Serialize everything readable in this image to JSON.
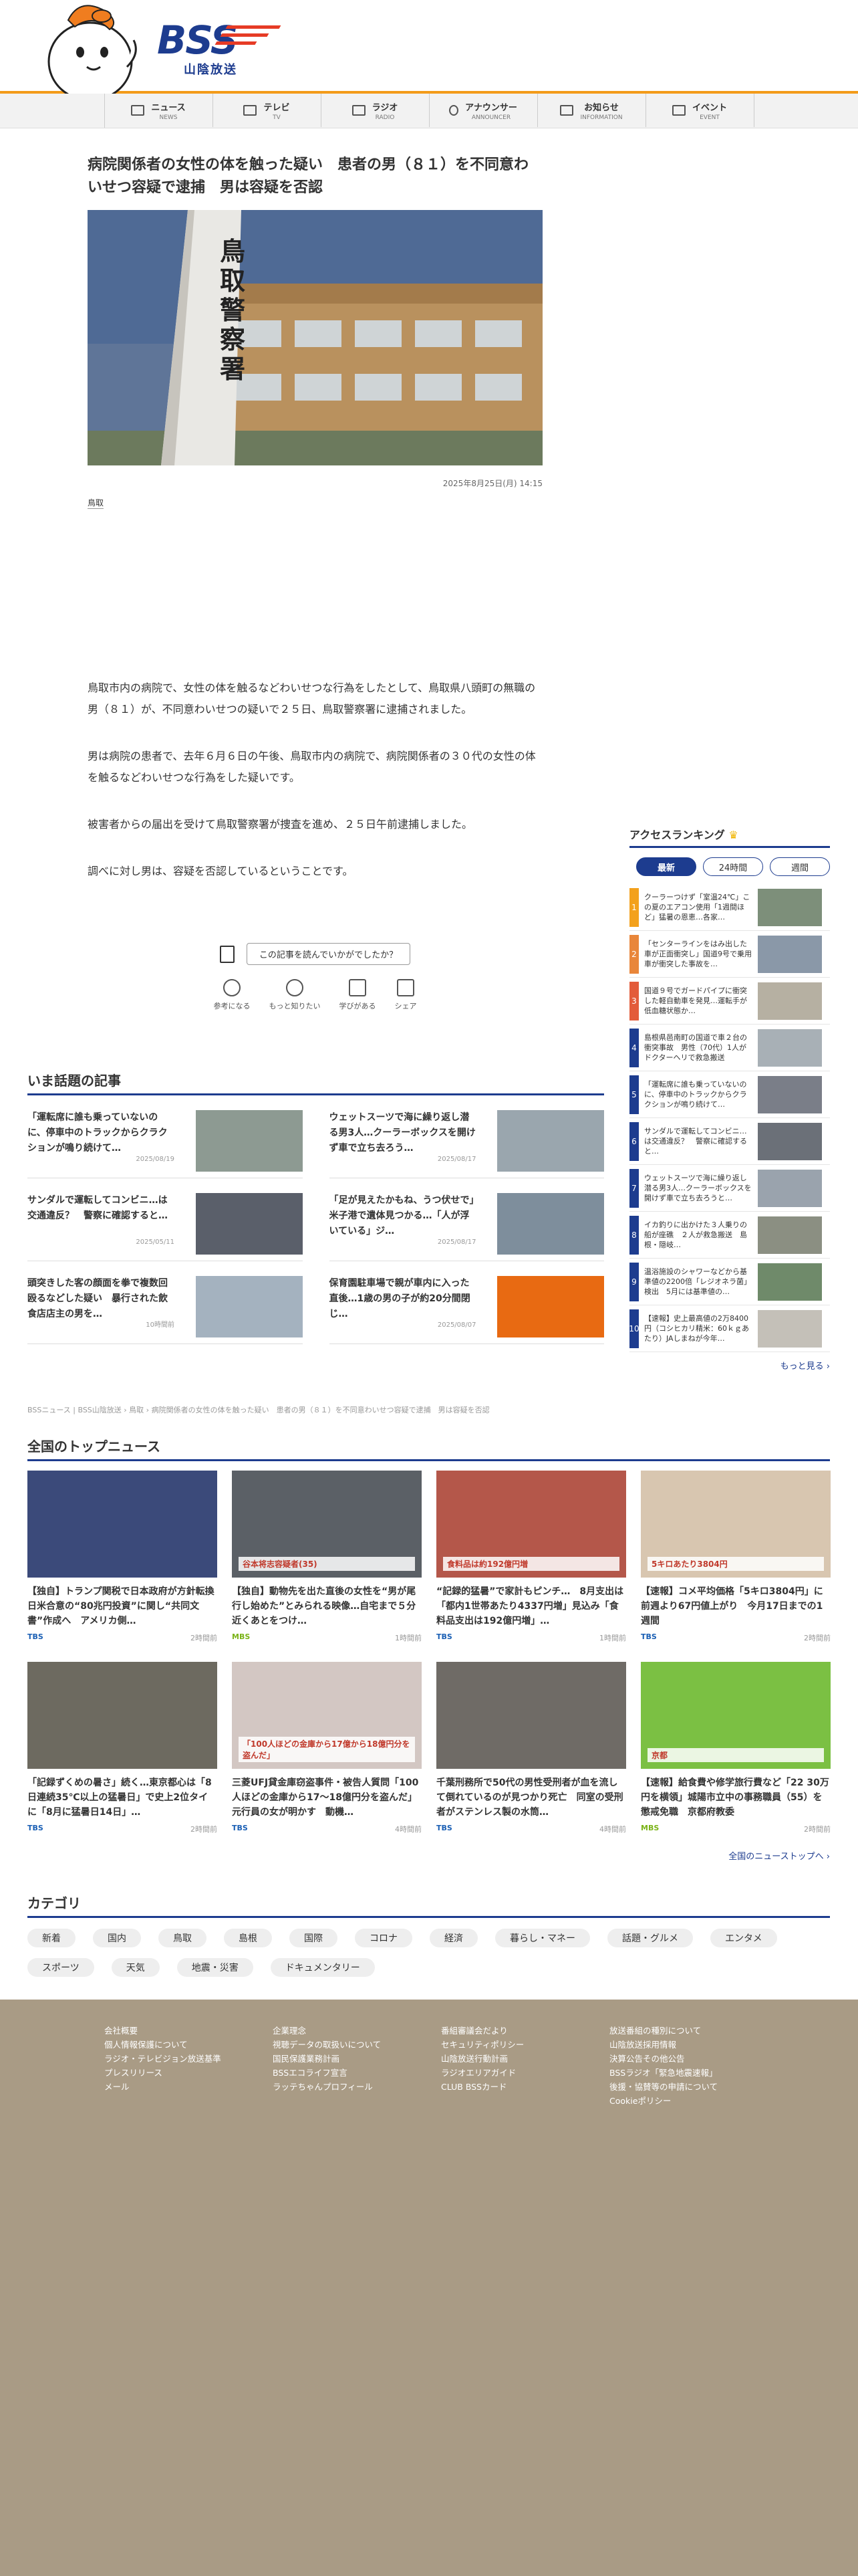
{
  "header": {
    "logo_text": "BSS",
    "logo_sub": "山陰放送",
    "colors": {
      "brand_blue": "#1d3c8f",
      "accent_orange": "#f39b1a",
      "accent_red": "#e63b25"
    }
  },
  "nav": [
    {
      "ja": "ニュース",
      "en": "NEWS",
      "icon": "news-icon"
    },
    {
      "ja": "テレビ",
      "en": "TV",
      "icon": "tv-icon"
    },
    {
      "ja": "ラジオ",
      "en": "RADIO",
      "icon": "radio-icon"
    },
    {
      "ja": "アナウンサー",
      "en": "ANNOUNCER",
      "icon": "microphone-icon"
    },
    {
      "ja": "お知らせ",
      "en": "INFORMATION",
      "icon": "megaphone-icon"
    },
    {
      "ja": "イベント",
      "en": "EVENT",
      "icon": "calendar-icon"
    }
  ],
  "article": {
    "title": "病院関係者の女性の体を触った疑い　患者の男（８１）を不同意わいせつ容疑で逮捕　男は容疑を否認",
    "photo_sign": "鳥取警察署",
    "date": "2025年8月25日(月) 14:15",
    "tag": "鳥取",
    "paragraphs": [
      "鳥取市内の病院で、女性の体を触るなどわいせつな行為をしたとして、鳥取県八頭町の無職の男（８１）が、不同意わいせつの疑いで２５日、鳥取警察署に逮捕されました。",
      "男は病院の患者で、去年６月６日の午後、鳥取市内の病院で、病院関係者の３０代の女性の体を触るなどわいせつな行為をした疑いです。",
      "被害者からの届出を受けて鳥取警察署が捜査を進め、２５日午前逮捕しました。",
      "調べに対し男は、容疑を否認しているということです。"
    ]
  },
  "feedback": {
    "question": "この記事を読んでいかがでしたか？",
    "reactions": [
      "参考になる",
      "もっと知りたい",
      "学びがある",
      "シェア"
    ]
  },
  "topics": {
    "title": "いま話題の記事",
    "items": [
      {
        "text": "「運転席に誰も乗っていないのに、停車中のトラックからクラクションが鳴り続けて…",
        "date": "2025/08/19"
      },
      {
        "text": "ウェットスーツで海に繰り返し潜る男3人…クーラーボックスを開けず車で立ち去ろう…",
        "date": "2025/08/17"
      },
      {
        "text": "サンダルで運転してコンビニ…は交通違反？　警察に確認すると…",
        "date": "2025/05/11"
      },
      {
        "text": "「足が見えたかもね、うつ伏せで」米子港で遺体見つかる…「人が浮いている」ジ…",
        "date": "2025/08/17"
      },
      {
        "text": "頭突きした客の顔面を拳で複数回殴るなどした疑い　暴行された飲食店店主の男を…",
        "date": "10時間前"
      },
      {
        "text": "保育園駐車場で親が車内に入った直後…1歳の男の子が約20分間閉じ…",
        "date": "2025/08/07"
      }
    ]
  },
  "ranking": {
    "title": "アクセスランキング",
    "tabs": [
      "最新",
      "24時間",
      "週間"
    ],
    "items": [
      {
        "rank": "1",
        "text": "クーラーつけず「室温24℃」この夏のエアコン使用「1週間ほど」猛暑の恩恵…各家…"
      },
      {
        "rank": "2",
        "text": "「センターラインをはみ出した車が正面衝突し」国道9号で乗用車が衝突した事故を…"
      },
      {
        "rank": "3",
        "text": "国道９号でガードパイプに衝突した軽自動車を発見…運転手が低血糖状態か…"
      },
      {
        "rank": "4",
        "text": "島根県邑南町の国道で車２台の衝突事故　男性（70代）1人がドクターヘリで救急搬送"
      },
      {
        "rank": "5",
        "text": "「運転席に誰も乗っていないのに、停車中のトラックからクラクションが鳴り続けて…"
      },
      {
        "rank": "6",
        "text": "サンダルで運転してコンビニ…は交通違反？　警察に確認すると…"
      },
      {
        "rank": "7",
        "text": "ウェットスーツで海に繰り返し潜る男3人…クーラーボックスを開けず車で立ち去ろうと…"
      },
      {
        "rank": "8",
        "text": "イカ釣りに出かけた３人乗りの船が座礁　２人が救急搬送　島根・隠岐…"
      },
      {
        "rank": "9",
        "text": "温浴施設のシャワーなどから基準値の2200倍「レジオネラ菌」検出　5月には基準値の…"
      },
      {
        "rank": "10",
        "text": "【速報】史上最高値の2万8400円（コシヒカリ精米：60ｋｇあたり）JAしまねが今年…"
      }
    ],
    "more": "もっと見る"
  },
  "breadcrumb": "BSSニュース | BSS山陰放送 › 鳥取 › 病院関係者の女性の体を触った疑い　患者の男（８１）を不同意わいせつ容疑で逮捕　男は容疑を否認",
  "national": {
    "title": "全国のトップニュース",
    "cards": [
      {
        "text": "【独自】トランプ関税で日本政府が方針転換　日米合意の“80兆円投資”に関し“共同文書”作成へ　アメリカ側…",
        "src": "TBS",
        "time": "2時間前"
      },
      {
        "text": "【独自】動物先を出た直後の女性を“男が尾行し始めた”とみられる映像…自宅まで５分近くあとをつけ…",
        "src": "MBS",
        "time": "1時間前"
      },
      {
        "text": "“記録的猛暑”で家計もピンチ…　8月支出は「都内1世帯あたり4337円増」見込み「食料品支出は192億円増」…",
        "src": "TBS",
        "time": "1時間前"
      },
      {
        "text": "【速報】コメ平均価格「5キロ3804円」に　前週より67円値上がり　今月17日までの1週間",
        "src": "TBS",
        "time": "2時間前"
      },
      {
        "text": "「記録ずくめの暑さ」続く…東京都心は「8日連続35℃以上の猛暑日」で史上2位タイに「8月に猛暑日14日」…",
        "src": "TBS",
        "time": "2時間前"
      },
      {
        "text": "三菱UFJ貸金庫窃盗事件・被告人質問「100人ほどの金庫から17～18億円分を盗んだ」元行員の女が明かす　動機…",
        "src": "TBS",
        "time": "4時間前"
      },
      {
        "text": "千葉刑務所で50代の男性受刑者が血を流して倒れているのが見つかり死亡　同室の受刑者がステンレス製の水筒…",
        "src": "TBS",
        "time": "4時間前"
      },
      {
        "text": "【速報】給食費や修学旅行費など「22 30万円を横領」城陽市立中の事務職員（55）を懲戒免職　京都府教委",
        "src": "MBS",
        "time": "2時間前"
      }
    ],
    "photo_captions": [
      "",
      "谷本将志容疑者(35)",
      "食料品は約192億円増",
      "5キロあたり3804円",
      "",
      "「100人ほどの金庫から17億から18億円分を盗んだ」",
      "",
      "京都"
    ],
    "more": "全国のニューストップへ"
  },
  "category": {
    "title": "カテゴリ",
    "chips": [
      "新着",
      "国内",
      "鳥取",
      "島根",
      "国際",
      "コロナ",
      "経済",
      "暮らし・マネー",
      "話題・グルメ",
      "エンタメ",
      "スポーツ",
      "天気",
      "地震・災害",
      "ドキュメンタリー"
    ]
  },
  "footer": {
    "cols": [
      [
        "会社概要",
        "個人情報保護について",
        "ラジオ・テレビジョン放送基準",
        "プレスリリース",
        "メール"
      ],
      [
        "企業理念",
        "視聴データの取扱いについて",
        "国民保護業務計画",
        "BSSエコライフ宣言",
        "ラッテちゃんプロフィール"
      ],
      [
        "番組審議会だより",
        "セキュリティポリシー",
        "山陰放送行動計画",
        "ラジオエリアガイド",
        "CLUB BSSカード"
      ],
      [
        "放送番組の種別について",
        "山陰放送採用情報",
        "決算公告その他公告",
        "BSSラジオ「緊急地震速報」",
        "後援・協賛等の申請について",
        "Cookieポリシー"
      ]
    ]
  }
}
